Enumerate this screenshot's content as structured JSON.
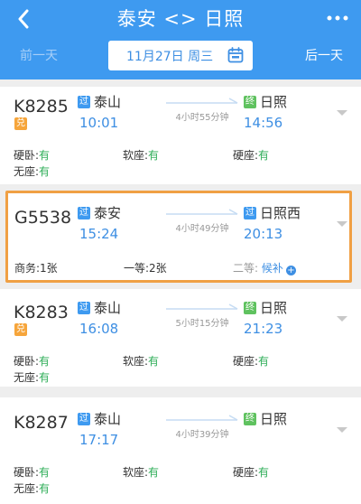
{
  "header": {
    "title": "泰安 <> 日照",
    "prev_day": "前一天",
    "next_day": "后一天",
    "date": "11月27日 周三"
  },
  "trains": [
    {
      "number": "K8285",
      "dui": "兑",
      "from_badge": "过",
      "from_station": "泰山",
      "depart": "10:01",
      "duration": "4小时55分钟",
      "to_badge": "终",
      "to_station": "日照",
      "arrive": "14:56",
      "seats": [
        {
          "label": "硬卧:",
          "value": "有"
        },
        {
          "label": "软座:",
          "value": "有"
        },
        {
          "label": "硬座:",
          "value": "有"
        },
        {
          "label": "无座:",
          "value": "有"
        }
      ]
    },
    {
      "number": "G5538",
      "from_badge": "过",
      "from_station": "泰安",
      "depart": "15:24",
      "duration": "4小时49分钟",
      "to_badge": "过",
      "to_station": "日照西",
      "arrive": "20:13",
      "seats": [
        {
          "label": "商务:",
          "value": "1张"
        },
        {
          "label": "一等:",
          "value": "2张"
        },
        {
          "label": "二等:",
          "value": "候补"
        }
      ]
    },
    {
      "number": "K8283",
      "dui": "兑",
      "from_badge": "过",
      "from_station": "泰山",
      "depart": "16:08",
      "duration": "5小时15分钟",
      "to_badge": "终",
      "to_station": "日照",
      "arrive": "21:23",
      "seats": [
        {
          "label": "硬卧:",
          "value": "有"
        },
        {
          "label": "软座:",
          "value": "有"
        },
        {
          "label": "硬座:",
          "value": "有"
        },
        {
          "label": "无座:",
          "value": "有"
        }
      ]
    },
    {
      "number": "K8287",
      "from_badge": "过",
      "from_station": "泰山",
      "depart": "17:17",
      "duration": "4小时39分钟",
      "to_badge": "终",
      "to_station": "日照",
      "arrive": "",
      "seats": [
        {
          "label": "硬卧:",
          "value": "有"
        },
        {
          "label": "软座:",
          "value": "有"
        },
        {
          "label": "硬座:",
          "value": "有"
        },
        {
          "label": "无座:",
          "value": "有"
        }
      ]
    }
  ],
  "colors": {
    "header_bg": "#3e9af0",
    "time_blue": "#3e8fe3",
    "available_green": "#2fae58",
    "highlight_orange": "#f0a044",
    "badge_orange": "#f6a53b",
    "badge_green": "#5fc25f"
  },
  "icons": {
    "back": "chevron-left-icon",
    "more": "more-dots-icon",
    "calendar": "calendar-icon",
    "expand": "chevron-down-icon",
    "add": "plus-circle-icon"
  }
}
